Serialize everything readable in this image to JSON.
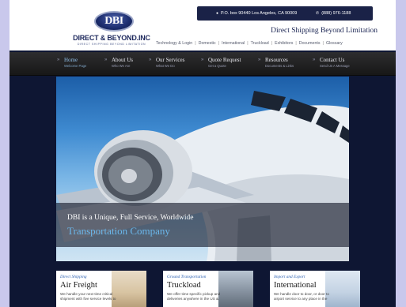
{
  "contact": {
    "address": "P.O. box 90440 Los Angeles, CA 90009",
    "phone": "(888) 976-1188"
  },
  "logo": {
    "mark": "DBI",
    "name": "DIRECT & BEYOND.INC",
    "sub": "DIRECT SHIPPING BEYOND LIMITATION"
  },
  "tagline": "Direct Shipping Beyond Limitation",
  "top_nav": [
    "Technology & Login",
    "Domestic",
    "International",
    "Truckload",
    "Exhibitors",
    "Documents",
    "Glossary"
  ],
  "main_nav": [
    {
      "label": "Home",
      "sub": "Welcome Page",
      "active": true
    },
    {
      "label": "About Us",
      "sub": "Who We Are",
      "active": false
    },
    {
      "label": "Our Services",
      "sub": "What We Do",
      "active": false
    },
    {
      "label": "Quote Request",
      "sub": "Get a Quote",
      "active": false
    },
    {
      "label": "Resources",
      "sub": "Documents & Links",
      "active": false
    },
    {
      "label": "Contact Us",
      "sub": "Send Us A Message",
      "active": false
    }
  ],
  "hero": {
    "line1": "DBI is a Unique, Full Service, Worldwide",
    "line2": "Transportation Company"
  },
  "cards": [
    {
      "eyebrow": "Direct Shipping",
      "title": "Air Freight",
      "body": "We handle your next time critical shipment with five service levels to"
    },
    {
      "eyebrow": "Ground Transportation",
      "title": "Truckload",
      "body": "We offer time specific pickup and deliveries anywhere in the US &"
    },
    {
      "eyebrow": "Import and Export",
      "title": "International",
      "body": "We handle door to door, or door to airport service to any place in the"
    }
  ],
  "colors": {
    "page_background": "#c9c8ec",
    "site_background": "#0e1633",
    "nav_background": "#1f1f21",
    "accent_blue": "#6bb8ec",
    "brand_navy": "#1f2a5e"
  }
}
